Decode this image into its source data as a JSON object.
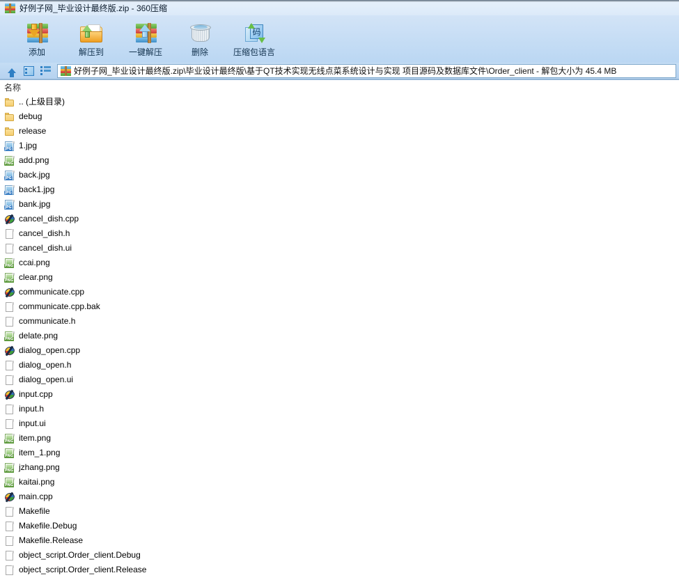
{
  "window": {
    "title": "好例子网_毕业设计最终版.zip - 360压缩",
    "title_icon": "archive-icon"
  },
  "toolbar": {
    "buttons": [
      {
        "label": "添加",
        "icon": "add-archive-icon"
      },
      {
        "label": "解压到",
        "icon": "extract-to-folder-icon"
      },
      {
        "label": "一键解压",
        "icon": "one-click-extract-icon"
      },
      {
        "label": "删除",
        "icon": "trash-icon"
      },
      {
        "label": "压缩包语言",
        "icon": "archive-language-icon"
      }
    ]
  },
  "addressbar": {
    "nav_icons": [
      "up-arrow-icon",
      "preview-panel-icon",
      "list-view-icon"
    ],
    "path_icon": "archive-icon",
    "path": "好例子网_毕业设计最终版.zip\\毕业设计最终版\\基于QT技术实现无线点菜系统设计与实现 项目源码及数据库文件\\Order_client - 解包大小为 45.4 MB"
  },
  "filelist": {
    "header": {
      "name": "名称"
    },
    "rows": [
      {
        "name": ".. (上级目录)",
        "icon": "folder"
      },
      {
        "name": "debug",
        "icon": "folder"
      },
      {
        "name": "release",
        "icon": "folder"
      },
      {
        "name": "1.jpg",
        "icon": "jpg"
      },
      {
        "name": "add.png",
        "icon": "png"
      },
      {
        "name": "back.jpg",
        "icon": "jpg"
      },
      {
        "name": "back1.jpg",
        "icon": "jpg"
      },
      {
        "name": "bank.jpg",
        "icon": "jpg"
      },
      {
        "name": "cancel_dish.cpp",
        "icon": "cpp"
      },
      {
        "name": "cancel_dish.h",
        "icon": "doc"
      },
      {
        "name": "cancel_dish.ui",
        "icon": "doc"
      },
      {
        "name": "ccai.png",
        "icon": "png"
      },
      {
        "name": "clear.png",
        "icon": "png"
      },
      {
        "name": "communicate.cpp",
        "icon": "cpp"
      },
      {
        "name": "communicate.cpp.bak",
        "icon": "doc"
      },
      {
        "name": "communicate.h",
        "icon": "doc"
      },
      {
        "name": "delate.png",
        "icon": "png"
      },
      {
        "name": "dialog_open.cpp",
        "icon": "cpp"
      },
      {
        "name": "dialog_open.h",
        "icon": "doc"
      },
      {
        "name": "dialog_open.ui",
        "icon": "doc"
      },
      {
        "name": "input.cpp",
        "icon": "cpp"
      },
      {
        "name": "input.h",
        "icon": "doc"
      },
      {
        "name": "input.ui",
        "icon": "doc"
      },
      {
        "name": "item.png",
        "icon": "png"
      },
      {
        "name": "item_1.png",
        "icon": "png"
      },
      {
        "name": "jzhang.png",
        "icon": "png"
      },
      {
        "name": "kaitai.png",
        "icon": "png"
      },
      {
        "name": "main.cpp",
        "icon": "cpp"
      },
      {
        "name": "Makefile",
        "icon": "doc"
      },
      {
        "name": "Makefile.Debug",
        "icon": "doc"
      },
      {
        "name": "Makefile.Release",
        "icon": "doc"
      },
      {
        "name": "object_script.Order_client.Debug",
        "icon": "doc"
      },
      {
        "name": "object_script.Order_client.Release",
        "icon": "doc"
      }
    ]
  },
  "icon_labels": {
    "jpg": "JPG",
    "png": "PNG",
    "lang_char": "码"
  },
  "colors": {
    "chrome_top": "#dce9f8",
    "chrome_bottom": "#b3d2f1",
    "addressbar": "#bdd7f2",
    "list_bg": "#ffffff",
    "text": "#000000",
    "folder": "#f6cf72",
    "jpg_tag": "#3b7fc4",
    "png_tag": "#5f9b3f"
  }
}
